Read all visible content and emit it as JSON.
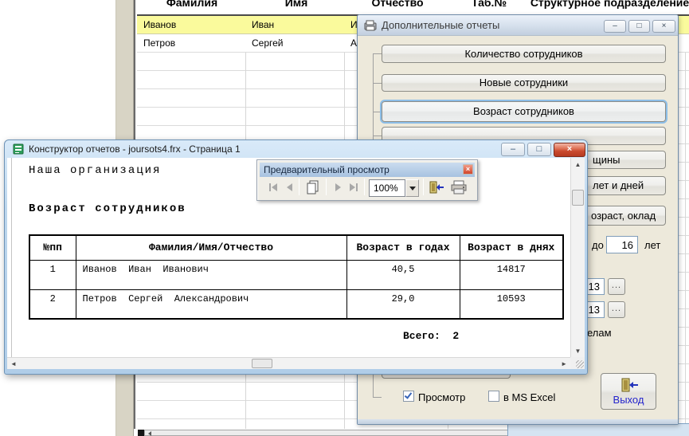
{
  "colors": {
    "row_highlight": "#FAFA9C",
    "dialog_background": "#EDE9DB",
    "exit_text": "#2323CD",
    "close_button_red": "#C94A2F"
  },
  "bg_table": {
    "headers": [
      "Фамилия",
      "Имя",
      "Отчество",
      "Таб.№",
      "Структурное подразделение"
    ],
    "rows": [
      [
        "Иванов",
        "Иван",
        "Иванович"
      ],
      [
        "Петров",
        "Сергей",
        "Александрович"
      ]
    ]
  },
  "reports_dialog": {
    "title": "Дополнительные отчеты",
    "window_buttons": {
      "minimize": "–",
      "maximize": "□",
      "close": "×"
    },
    "buttons": [
      "Количество сотрудников",
      "Новые сотрудники",
      "Возраст сотрудников"
    ],
    "covered_buttons": [
      {
        "fragment": "щины"
      },
      {
        "fragment": "лет и дней"
      },
      {
        "fragment": "озраст, оклад"
      }
    ],
    "age_filter": {
      "label_before": "до",
      "value": "16",
      "label_after": "лет"
    },
    "pickers": [
      {
        "value": "13",
        "button_label": "..."
      },
      {
        "value": "13",
        "button_label": "..."
      }
    ],
    "dept_fragment": "елам",
    "checkboxes": {
      "preview": {
        "label": "Просмотр",
        "checked": true
      },
      "excel": {
        "label": "в MS Excel",
        "checked": false
      }
    },
    "exit_label": "Выход"
  },
  "report_window": {
    "title": "Конструктор отчетов - joursots4.frx - Страница 1",
    "window_buttons": {
      "minimize": "–",
      "maximize": "□",
      "close": "×"
    },
    "org_name": "Наша организация",
    "heading": "Возраст сотрудников",
    "table": {
      "headers": [
        "№пп",
        "Фамилия/Имя/Отчество",
        "Возраст в годах",
        "Возраст в днях"
      ],
      "rows": [
        [
          "1",
          "Иванов  Иван  Иванович",
          "40,5",
          "14817"
        ],
        [
          "2",
          "Петров  Сергей  Александрович",
          "29,0",
          "10593"
        ]
      ]
    },
    "total": "Всего:  2"
  },
  "preview_toolbar": {
    "title": "Предварительный просмотр",
    "close_glyph": "×",
    "zoom_value": "100%",
    "icons": [
      "first-page",
      "prev-page",
      "copy-pages",
      "next-page",
      "last-page",
      "zoom-combo",
      "close-preview-door",
      "print"
    ]
  }
}
